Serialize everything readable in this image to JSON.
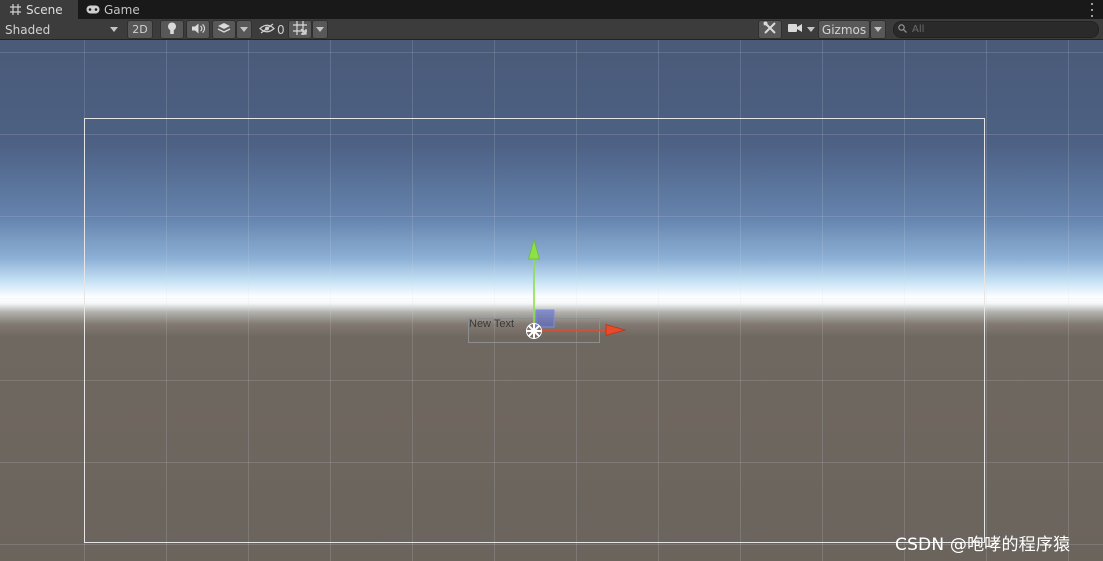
{
  "tabs": [
    {
      "label": "Scene",
      "icon": "grid-hash-icon",
      "active": true
    },
    {
      "label": "Game",
      "icon": "gamepad-icon",
      "active": false
    }
  ],
  "toolbar": {
    "draw_mode": "Shaded",
    "mode_2d": "2D",
    "hidden_count": "0",
    "gizmos": "Gizmos",
    "search_placeholder": "All",
    "icons": [
      "lightbulb-icon",
      "audio-icon",
      "effects-layers-icon",
      "visibility-eye-icon",
      "grid-snap-icon",
      "tools-icon",
      "camera-icon",
      "search-icon"
    ]
  },
  "scene": {
    "selected_object_text": "New Text",
    "handle_colors": {
      "x": "#e84a2c",
      "y": "#8ee04a",
      "z": "#5a6ad6"
    }
  },
  "watermark": "CSDN @咆哮的程序猿"
}
